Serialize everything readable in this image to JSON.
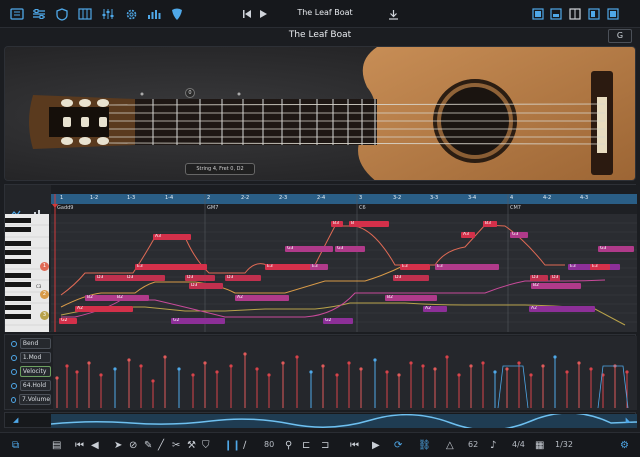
{
  "topbar": {
    "song_title": "The Leaf Boat",
    "icons": [
      "library-icon",
      "mixer-icon",
      "shield-icon",
      "tracks-icon",
      "sliders-icon",
      "gear-icon",
      "levels-icon",
      "pick-icon",
      "skip-back-icon",
      "play-icon",
      "download-icon",
      "layout-1-icon",
      "layout-2-icon",
      "layout-3-icon",
      "layout-4-icon",
      "layout-5-icon"
    ]
  },
  "header": {
    "title": "The Leaf Boat",
    "key": "G"
  },
  "guitar": {
    "fret_marker": "0",
    "string_info": "String 4, Fret 0, D2"
  },
  "timeline": {
    "beats": [
      "1",
      "1-2",
      "1-3",
      "1-4",
      "2",
      "2-2",
      "2-3",
      "2-4",
      "3",
      "3-2",
      "3-3",
      "3-4",
      "4",
      "4-2",
      "4-3"
    ],
    "chords": [
      "Gadd9",
      "GM7",
      "C6",
      "CM7"
    ]
  },
  "lanes": [
    {
      "label": "Bend",
      "active": false
    },
    {
      "label": "1.Mod",
      "active": false
    },
    {
      "label": "Velocity",
      "active": true
    },
    {
      "label": "64.Hold",
      "active": false
    },
    {
      "label": "7.Volume",
      "active": false
    }
  ],
  "string_numbers": [
    "1",
    "2",
    "3"
  ],
  "piano_label": "C3",
  "notes": [
    {
      "label": "A3",
      "color": "#d4304a"
    },
    {
      "label": "E3",
      "color": "#d4304a"
    },
    {
      "label": "D3",
      "color": "#c0304e"
    },
    {
      "label": "D3",
      "color": "#c0304e"
    },
    {
      "label": "B2",
      "color": "#b03a8a"
    },
    {
      "label": "B2",
      "color": "#b03a8a"
    },
    {
      "label": "G2",
      "color": "#d4304a"
    },
    {
      "label": "A2",
      "color": "#d4304a"
    },
    {
      "label": "D3",
      "color": "#c0304e"
    },
    {
      "label": "E3",
      "color": "#d4304a"
    },
    {
      "label": "G3",
      "color": "#b03a8a"
    },
    {
      "label": "B3",
      "color": "#d4304a"
    },
    {
      "label": "D3",
      "color": "#c0304e"
    },
    {
      "label": "G2",
      "color": "#8d2f98"
    },
    {
      "label": "D3",
      "color": "#c0304e"
    },
    {
      "label": "E3",
      "color": "#b03a8a"
    },
    {
      "label": "G3",
      "color": "#b03a8a"
    },
    {
      "label": "B3",
      "color": "#d4304a"
    },
    {
      "label": "B",
      "color": "#d4304a"
    },
    {
      "label": "G2",
      "color": "#8d2f98"
    },
    {
      "label": "A2",
      "color": "#b03a8a"
    },
    {
      "label": "D3",
      "color": "#c0304e"
    },
    {
      "label": "E3",
      "color": "#b03a8a"
    },
    {
      "label": "A3",
      "color": "#d4304a"
    },
    {
      "label": "B3",
      "color": "#d4304a"
    },
    {
      "label": "G3",
      "color": "#b03a8a"
    },
    {
      "label": "D3",
      "color": "#c0304e"
    },
    {
      "label": "E3",
      "color": "#d4304a"
    },
    {
      "label": "B2",
      "color": "#b03a8a"
    },
    {
      "label": "A2",
      "color": "#8d2f98"
    },
    {
      "label": "G3",
      "color": "#b03a8a"
    },
    {
      "label": "E3",
      "color": "#8d2f98"
    },
    {
      "label": "B2",
      "color": "#b03a8a"
    },
    {
      "label": "D3",
      "color": "#c0304e"
    },
    {
      "label": "E3",
      "color": "#d4304a"
    },
    {
      "label": "A2",
      "color": "#8d2f98"
    }
  ],
  "bottombar": {
    "tempo": "80",
    "meter_a": "62",
    "meter_b": "62",
    "time_sig": "4/4",
    "grid": "1/32"
  },
  "colors": {
    "accent": "#4fa8e8",
    "note_red": "#d4304a",
    "note_purple": "#8d2f98",
    "timeline_bg": "#2a5e86"
  }
}
